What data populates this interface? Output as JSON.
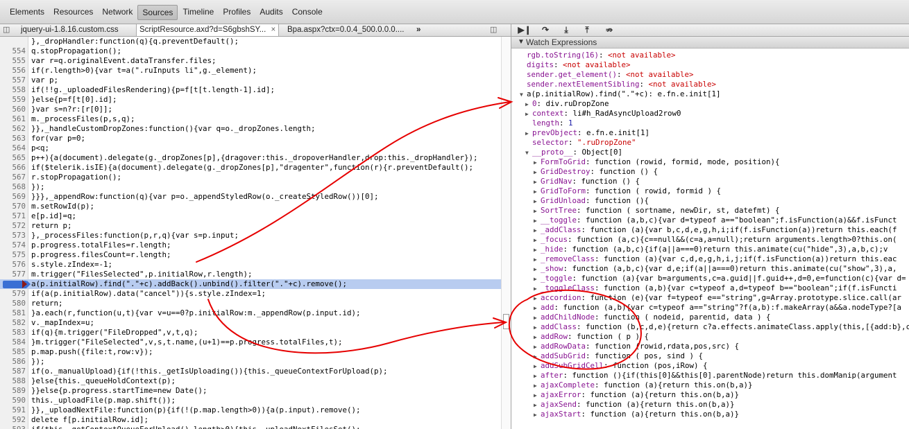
{
  "toolbar": {
    "tabs": [
      "Elements",
      "Resources",
      "Network",
      "Sources",
      "Timeline",
      "Profiles",
      "Audits",
      "Console"
    ],
    "active": "Sources"
  },
  "file_tabs": {
    "tab1": "jquery-ui-1.8.16.custom.css",
    "tab2": "ScriptResource.axd?d=S6gbshSY...",
    "tab3": "Bpa.aspx?ctx=0.0.4_500.0.0.0....",
    "tab2_close": "×",
    "more": "»"
  },
  "code_lines": [
    {
      "n": "",
      "t": "},_dropHandler:function(q){q.preventDefault();"
    },
    {
      "n": "554",
      "t": "q.stopPropagation();"
    },
    {
      "n": "555",
      "t": "var r=q.originalEvent.dataTransfer.files;"
    },
    {
      "n": "556",
      "t": "if(r.length>0){var t=a(\".ruInputs li\",g._element);"
    },
    {
      "n": "557",
      "t": "var p;"
    },
    {
      "n": "558",
      "t": "if(!!g._uploadedFilesRendering){p=f[t[t.length-1].id];"
    },
    {
      "n": "559",
      "t": "}else{p=f[t[0].id];"
    },
    {
      "n": "560",
      "t": "}var s=n?r:[r[0]];"
    },
    {
      "n": "561",
      "t": "m._processFiles(p,s,q);"
    },
    {
      "n": "562",
      "t": "}},_handleCustomDropZones:function(){var q=o._dropZones.length;"
    },
    {
      "n": "563",
      "t": "for(var p=0;"
    },
    {
      "n": "564",
      "t": "p<q;"
    },
    {
      "n": "565",
      "t": "p++){a(document).delegate(g._dropZones[p],{dragover:this._dropoverHandler,drop:this._dropHandler});"
    },
    {
      "n": "566",
      "t": "if($telerik.isIE){a(document).delegate(g._dropZones[p],\"dragenter\",function(r){r.preventDefault();"
    },
    {
      "n": "567",
      "t": "r.stopPropagation();"
    },
    {
      "n": "568",
      "t": "});"
    },
    {
      "n": "569",
      "t": "}}},_appendRow:function(q){var p=o._appendStyledRow(o._createStyledRow())[0];"
    },
    {
      "n": "570",
      "t": "m.setRowId(p);"
    },
    {
      "n": "571",
      "t": "e[p.id]=q;"
    },
    {
      "n": "572",
      "t": "return p;"
    },
    {
      "n": "573",
      "t": "},_processFiles:function(p,r,q){var s=p.input;"
    },
    {
      "n": "574",
      "t": "p.progress.totalFiles=r.length;"
    },
    {
      "n": "575",
      "t": "p.progress.filesCount=r.length;"
    },
    {
      "n": "576",
      "t": "s.style.zIndex=-1;"
    },
    {
      "n": "577",
      "t": "m.trigger(\"FilesSelected\",p.initialRow,r.length);"
    },
    {
      "n": "578",
      "t": "a(p.initialRow).find(\".\"+c).addBack().unbind().filter(\".\"+c).remove();"
    },
    {
      "n": "579",
      "t": "if(a(p.initialRow).data(\"cancel\")){s.style.zIndex=1;"
    },
    {
      "n": "580",
      "t": "return;"
    },
    {
      "n": "581",
      "t": "}a.each(r,function(u,t){var v=u==0?p.initialRow:m._appendRow(p.input.id);"
    },
    {
      "n": "582",
      "t": "v._mapIndex=u;"
    },
    {
      "n": "583",
      "t": "if(q){m.trigger(\"FileDropped\",v,t,q);"
    },
    {
      "n": "584",
      "t": "}m.trigger(\"FileSelected\",v,s,t.name,(u+1)==p.progress.totalFiles,t);"
    },
    {
      "n": "585",
      "t": "p.map.push({file:t,row:v});"
    },
    {
      "n": "586",
      "t": "});"
    },
    {
      "n": "587",
      "t": "if(o._manualUpload){if(!this._getIsUploading()){this._queueContextForUpload(p);"
    },
    {
      "n": "588",
      "t": "}else{this._queueHoldContext(p);"
    },
    {
      "n": "589",
      "t": "}}else{p.progress.startTime=new Date();"
    },
    {
      "n": "590",
      "t": "this._uploadFile(p.map.shift());"
    },
    {
      "n": "591",
      "t": "}},_uploadNextFile:function(p){if(!(p.map.length>0)){a(p.input).remove();"
    },
    {
      "n": "592",
      "t": "delete f[p.initialRow.id];"
    },
    {
      "n": "593",
      "t": "if(this._getContextQueueForUpload().length>0){this._uploadNextFilesSet();"
    }
  ],
  "debugger": {
    "buttons": [
      "pause-resume",
      "step-over",
      "step-into",
      "step-out",
      "deactivate-breakpoints"
    ]
  },
  "watch": {
    "title": "Watch Expressions",
    "lines": [
      {
        "tri": "",
        "k": "rgb.toString(16)",
        "s": ": ",
        "v": "<not available>",
        "cls": "na",
        "ind": 0
      },
      {
        "tri": "",
        "k": "digits",
        "s": ": ",
        "v": "<not available>",
        "cls": "na",
        "ind": 0
      },
      {
        "tri": "",
        "k": "sender.get_element()",
        "s": ": ",
        "v": "<not available>",
        "cls": "na",
        "ind": 0
      },
      {
        "tri": "",
        "k": "sender.nextElementSibling",
        "s": ": ",
        "v": "<not available>",
        "cls": "na",
        "ind": 0
      },
      {
        "tri": "▼",
        "k": "a(p.initialRow).find(\".\"+c)",
        "s": ": ",
        "v": "e.fn.e.init[1]",
        "cls": "obj",
        "ind": 0
      },
      {
        "tri": "▶",
        "k": "0",
        "s": ": ",
        "v": "div.ruDropZone",
        "cls": "obj",
        "ind": 1
      },
      {
        "tri": "▶",
        "k": "context",
        "s": ": ",
        "v": "li#h_RadAsyncUpload2row0",
        "cls": "obj",
        "ind": 1
      },
      {
        "tri": "",
        "k": "length",
        "s": ": ",
        "v": "1",
        "cls": "num",
        "ind": 1
      },
      {
        "tri": "▶",
        "k": "prevObject",
        "s": ": ",
        "v": "e.fn.e.init[1]",
        "cls": "obj",
        "ind": 1
      },
      {
        "tri": "",
        "k": "selector",
        "s": ": ",
        "v": "\".ruDropZone\"",
        "cls": "str",
        "ind": 1
      },
      {
        "tri": "▼",
        "k": "__proto__",
        "s": ": ",
        "v": "Object[0]",
        "cls": "obj",
        "ind": 1
      },
      {
        "tri": "▶",
        "k": "FormToGrid",
        "s": ": ",
        "v": "function (rowid, formid, mode, position){",
        "cls": "obj",
        "ind": 2
      },
      {
        "tri": "▶",
        "k": "GridDestroy",
        "s": ": ",
        "v": "function () {",
        "cls": "obj",
        "ind": 2
      },
      {
        "tri": "▶",
        "k": "GridNav",
        "s": ": ",
        "v": "function () {",
        "cls": "obj",
        "ind": 2
      },
      {
        "tri": "▶",
        "k": "GridToForm",
        "s": ": ",
        "v": "function ( rowid, formid ) {",
        "cls": "obj",
        "ind": 2
      },
      {
        "tri": "▶",
        "k": "GridUnload",
        "s": ": ",
        "v": "function (){",
        "cls": "obj",
        "ind": 2
      },
      {
        "tri": "▶",
        "k": "SortTree",
        "s": ": ",
        "v": "function ( sortname, newDir, st, datefmt) {",
        "cls": "obj",
        "ind": 2
      },
      {
        "tri": "▶",
        "k": "__toggle",
        "s": ": ",
        "v": "function (a,b,c){var d=typeof a==\"boolean\";f.isFunction(a)&&f.isFunct",
        "cls": "obj",
        "ind": 2
      },
      {
        "tri": "▶",
        "k": "_addClass",
        "s": ": ",
        "v": "function (a){var b,c,d,e,g,h,i;if(f.isFunction(a))return this.each(f",
        "cls": "obj",
        "ind": 2
      },
      {
        "tri": "▶",
        "k": "_focus",
        "s": ": ",
        "v": "function (a,c){c==null&&(c=a,a=null);return arguments.length>0?this.on(",
        "cls": "obj",
        "ind": 2
      },
      {
        "tri": "▶",
        "k": "_hide",
        "s": ": ",
        "v": "function (a,b,c){if(a||a===0)return this.animate(cu(\"hide\",3),a,b,c);v",
        "cls": "obj",
        "ind": 2
      },
      {
        "tri": "▶",
        "k": "_removeClass",
        "s": ": ",
        "v": "function (a){var c,d,e,g,h,i,j;if(f.isFunction(a))return this.eac",
        "cls": "obj",
        "ind": 2
      },
      {
        "tri": "▶",
        "k": "_show",
        "s": ": ",
        "v": "function (a,b,c){var d,e;if(a||a===0)return this.animate(cu(\"show\",3),a,",
        "cls": "obj",
        "ind": 2
      },
      {
        "tri": "▶",
        "k": "_toggle",
        "s": ": ",
        "v": "function (a){var b=arguments,c=a.guid||f.guid++,d=0,e=function(c){var d=",
        "cls": "obj",
        "ind": 2
      },
      {
        "tri": "▶",
        "k": "_toggleClass",
        "s": ": ",
        "v": "function (a,b){var c=typeof a,d=typeof b==\"boolean\";if(f.isFuncti",
        "cls": "obj",
        "ind": 2
      },
      {
        "tri": "▶",
        "k": "accordion",
        "s": ": ",
        "v": "function (e){var f=typeof e==\"string\",g=Array.prototype.slice.call(ar",
        "cls": "obj",
        "ind": 2
      },
      {
        "tri": "▶",
        "k": "add",
        "s": ": ",
        "v": "function (a,b){var c=typeof a==\"string\"?f(a,b):f.makeArray(a&&a.nodeType?[a",
        "cls": "obj",
        "ind": 2
      },
      {
        "tri": "▶",
        "k": "addChildNode",
        "s": ": ",
        "v": "function ( nodeid, parentid, data ) {",
        "cls": "obj",
        "ind": 2
      },
      {
        "tri": "▶",
        "k": "addClass",
        "s": ": ",
        "v": "function (b,c,d,e){return c?a.effects.animateClass.apply(this,[{add:b},c,",
        "cls": "obj",
        "ind": 2
      },
      {
        "tri": "▶",
        "k": "addRow",
        "s": ": ",
        "v": "function ( p ) {",
        "cls": "obj",
        "ind": 2
      },
      {
        "tri": "▶",
        "k": "addRowData",
        "s": ": ",
        "v": "function (rowid,rdata,pos,src) {",
        "cls": "obj",
        "ind": 2
      },
      {
        "tri": "▶",
        "k": "addSubGrid",
        "s": ": ",
        "v": "function ( pos, sind ) {",
        "cls": "obj",
        "ind": 2
      },
      {
        "tri": "▶",
        "k": "addSubGridCell",
        "s": ": ",
        "v": "function (pos,iRow) {",
        "cls": "obj",
        "ind": 2
      },
      {
        "tri": "▶",
        "k": "after",
        "s": ": ",
        "v": "function (){if(this[0]&&this[0].parentNode)return this.domManip(argument",
        "cls": "obj",
        "ind": 2
      },
      {
        "tri": "▶",
        "k": "ajaxComplete",
        "s": ": ",
        "v": "function (a){return this.on(b,a)}",
        "cls": "obj",
        "ind": 2
      },
      {
        "tri": "▶",
        "k": "ajaxError",
        "s": ": ",
        "v": "function (a){return this.on(b,a)}",
        "cls": "obj",
        "ind": 2
      },
      {
        "tri": "▶",
        "k": "ajaxSend",
        "s": ": ",
        "v": "function (a){return this.on(b,a)}",
        "cls": "obj",
        "ind": 2
      },
      {
        "tri": "▶",
        "k": "ajaxStart",
        "s": ": ",
        "v": "function (a){return this.on(b,a)}",
        "cls": "obj",
        "ind": 2
      }
    ]
  },
  "colors": {
    "annotation": "#e60000",
    "highlight": "#b8ccf0",
    "breakpoint": "#3a6fd4"
  },
  "icons": {
    "tab_close": "close-icon",
    "tab_overflow": "chevron-right-icon",
    "pane_toggle": "toggle-pane-icon"
  }
}
